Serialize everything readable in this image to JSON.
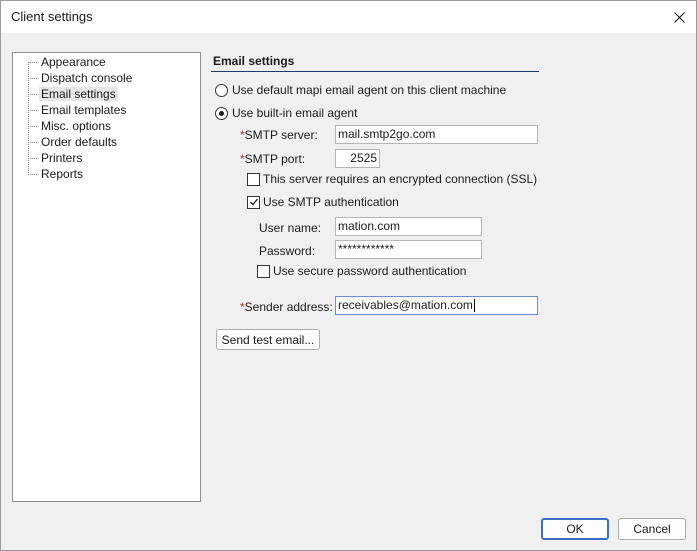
{
  "window": {
    "title": "Client settings"
  },
  "tree": {
    "items": [
      {
        "label": "Appearance"
      },
      {
        "label": "Dispatch console"
      },
      {
        "label": "Email settings",
        "selected": true
      },
      {
        "label": "Email templates"
      },
      {
        "label": "Misc. options"
      },
      {
        "label": "Order defaults"
      },
      {
        "label": "Printers"
      },
      {
        "label": "Reports"
      }
    ]
  },
  "email": {
    "section_title": "Email settings",
    "radio_mapi_label": "Use default mapi email agent on this client machine",
    "radio_builtin_label": "Use built-in email agent",
    "required_mark": "*",
    "smtp_server_label": "SMTP server:",
    "smtp_server_value": "mail.smtp2go.com",
    "smtp_port_label": "SMTP port:",
    "smtp_port_value": "2525",
    "ssl_label": "This server requires an encrypted connection (SSL)",
    "smtp_auth_label": "Use SMTP authentication",
    "username_label": "User name:",
    "username_value": "mation.com",
    "password_label": "Password:",
    "password_value": "************",
    "secure_auth_label": "Use secure password authentication",
    "sender_label": "Sender address:",
    "sender_value": "receivables@mation.com",
    "test_button_label": "Send test email..."
  },
  "footer": {
    "ok_label": "OK",
    "cancel_label": "Cancel"
  }
}
